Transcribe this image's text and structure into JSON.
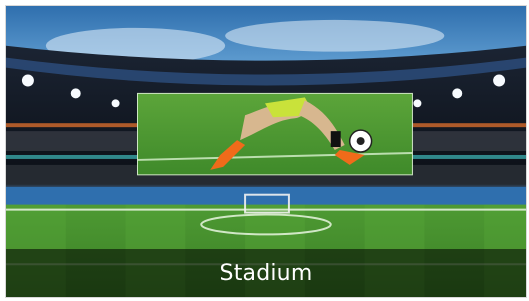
{
  "tile": {
    "caption": "Stadium",
    "image_subject": "stadium-scene",
    "colors": {
      "sky_top": "#2f6fae",
      "sky_bottom": "#8fc1e6",
      "pitch_light": "#5aa83a",
      "pitch_dark": "#3f8b2a",
      "caption_bg": "#000000",
      "caption_text": "#ffffff"
    }
  }
}
